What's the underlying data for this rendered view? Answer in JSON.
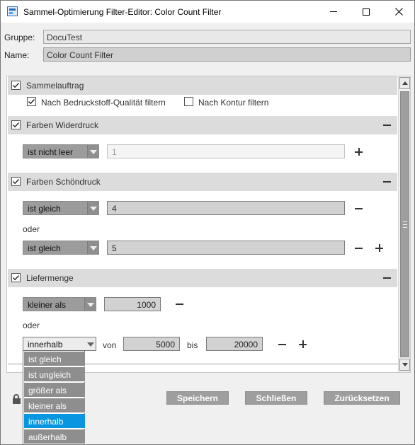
{
  "window": {
    "title": "Sammel-Optimierung Filter-Editor: Color Count Filter"
  },
  "header": {
    "group_label": "Gruppe:",
    "group_value": "DocuTest",
    "name_label": "Name:",
    "name_value": "Color Count Filter"
  },
  "sections": {
    "sammelauftrag": {
      "label": "Sammelauftrag",
      "checked": true,
      "opt1_label": "Nach Bedruckstoff-Qualität filtern",
      "opt1_checked": true,
      "opt2_label": "Nach Kontur filtern",
      "opt2_checked": false
    },
    "widerdruck": {
      "label": "Farben Widerdruck",
      "checked": true,
      "rows": [
        {
          "operator": "ist nicht leer",
          "value": "1"
        }
      ]
    },
    "schoendruck": {
      "label": "Farben Schöndruck",
      "checked": true,
      "or_label": "oder",
      "rows": [
        {
          "operator": "ist gleich",
          "value": "4"
        },
        {
          "operator": "ist gleich",
          "value": "5"
        }
      ]
    },
    "liefermenge": {
      "label": "Liefermenge",
      "checked": true,
      "or_label": "oder",
      "row1": {
        "operator": "kleiner als",
        "value": "1000"
      },
      "row2": {
        "operator": "innerhalb",
        "from_label": "von",
        "from_value": "5000",
        "to_label": "bis",
        "to_value": "20000"
      }
    }
  },
  "dropdown": {
    "options": [
      "ist gleich",
      "ist ungleich",
      "größer als",
      "kleiner als",
      "innerhalb",
      "außerhalb"
    ],
    "selected": "innerhalb"
  },
  "buttons": {
    "save": "Speichern",
    "close": "Schließen",
    "reset": "Zurücksetzen"
  },
  "colors": {
    "selection": "#0a95e0",
    "combo": "#9c9c9c",
    "section_header": "#dcdcdc"
  }
}
